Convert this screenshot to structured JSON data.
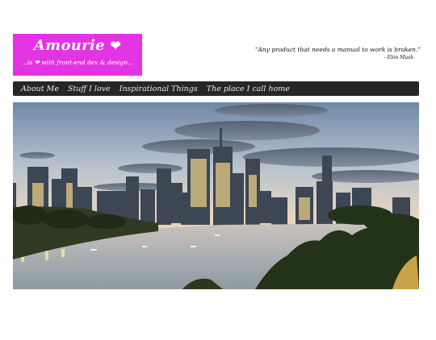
{
  "logo": {
    "title": "Amourie",
    "heart_icon": "heart-icon",
    "tagline": "...is ❤ with front-end dev & design..."
  },
  "quote": {
    "text": "\"Any product that needs a manual to work is broken.\"",
    "author": "- Elon Musk"
  },
  "nav": {
    "items": [
      {
        "label": "About Me"
      },
      {
        "label": "Stuff I love"
      },
      {
        "label": "Inspirational Things"
      },
      {
        "label": "The place I call home"
      }
    ]
  },
  "colors": {
    "logo_bg": "#e334e3",
    "nav_bg": "#262626",
    "nav_text": "#e9e9e9"
  }
}
